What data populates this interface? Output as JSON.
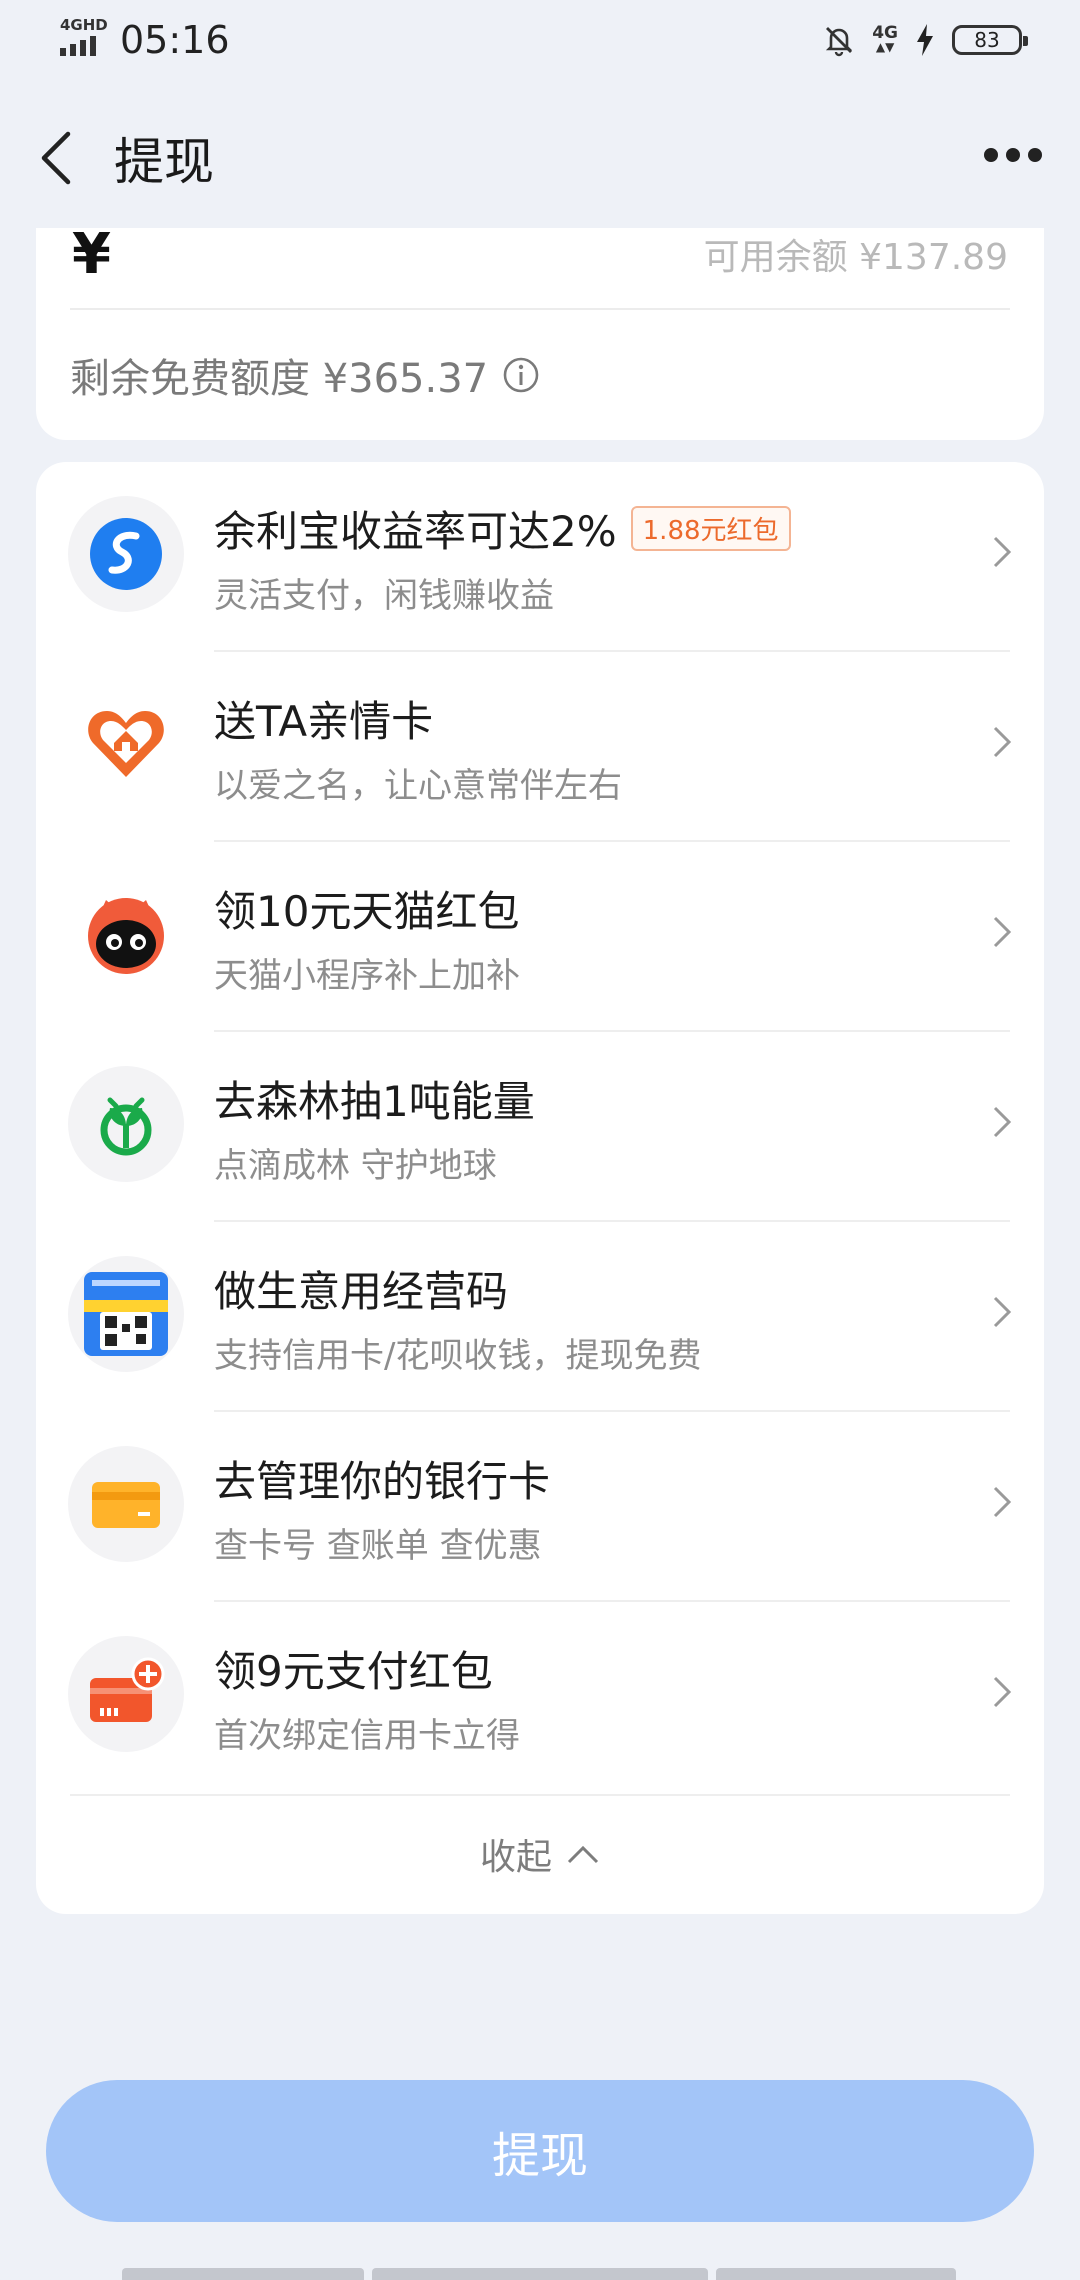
{
  "status_bar": {
    "network_label": "4GHD",
    "time": "05:16",
    "net_type": "4G",
    "battery": "83",
    "battery_level": 0.83
  },
  "nav": {
    "title": "提现"
  },
  "balance_card": {
    "currency_symbol": "¥",
    "available_balance": "可用余额 ¥137.89",
    "free_quota": "剩余免费额度 ¥365.37"
  },
  "services": [
    {
      "title": "余利宝收益率可达2%",
      "badge": "1.88元红包",
      "subtitle": "灵活支付，闲钱赚收益",
      "icon": "yulibao-icon"
    },
    {
      "title": "送TA亲情卡",
      "subtitle": "以爱之名，让心意常伴左右",
      "icon": "family-card-icon"
    },
    {
      "title": "领10元天猫红包",
      "subtitle": "天猫小程序补上加补",
      "icon": "tmall-icon"
    },
    {
      "title": "去森林抽1吨能量",
      "subtitle": "点滴成林 守护地球",
      "icon": "forest-icon"
    },
    {
      "title": "做生意用经营码",
      "subtitle": "支持信用卡/花呗收钱，提现免费",
      "icon": "business-qr-icon"
    },
    {
      "title": "去管理你的银行卡",
      "subtitle": "查卡号 查账单 查优惠",
      "icon": "bank-card-icon"
    },
    {
      "title": "领9元支付红包",
      "subtitle": "首次绑定信用卡立得",
      "icon": "credit-card-add-icon"
    }
  ],
  "collapse_label": "收起",
  "withdraw_button": "提现",
  "colors": {
    "background": "#eef1f7",
    "button": "#a3c5f8",
    "badge": "#ec6a2c"
  }
}
